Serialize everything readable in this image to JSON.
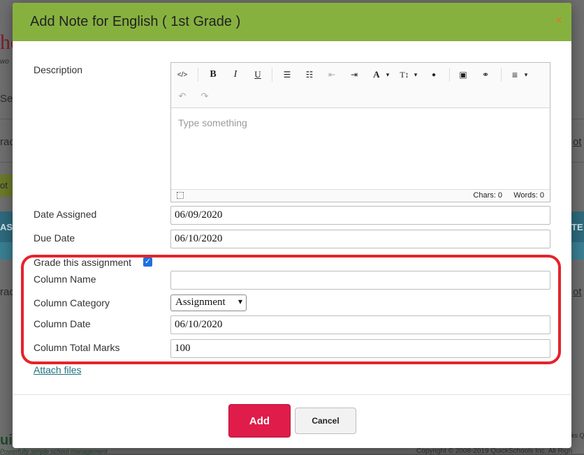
{
  "background": {
    "logo_fragment": "he",
    "fragment_tagline": "wo",
    "fragment_1": "Ser",
    "fragment_2": "rac",
    "fragment_3": "ot",
    "fragment_4": "ot",
    "fragment_5": "ASS",
    "fragment_6": "TE",
    "fragment_7": "rac",
    "fragment_8": "ot",
    "fragment_9": "ui",
    "footer_tagline": "Powerfully simple school management",
    "footer_right": "ks Q",
    "copyright": "Copyright © 2008-2019 QuickSchools Inc. All Righ"
  },
  "modal": {
    "title": "Add Note for English ( 1st Grade )",
    "close_symbol": "×"
  },
  "form": {
    "description_label": "Description",
    "editor": {
      "toolbar": {
        "code": "</>",
        "bold": "B",
        "italic": "I",
        "underline": "U",
        "bullet_list": "☰",
        "numbered_list": "☷",
        "outdent": "⇤",
        "indent": "⇥",
        "font_color": "A",
        "font_size": "T↕",
        "ink": "●",
        "image": "▣",
        "link": "⚭",
        "align": "≡",
        "dropdown": "▾",
        "undo": "↶",
        "redo": "↷"
      },
      "placeholder": "Type something",
      "chars_label": "Chars: 0",
      "words_label": "Words: 0"
    },
    "date_assigned_label": "Date Assigned",
    "date_assigned_value": "06/09/2020",
    "due_date_label": "Due Date",
    "due_date_value": "06/10/2020",
    "grade_label": "Grade this assignment",
    "grade_checked": true,
    "checkmark": "✓",
    "column_name_label": "Column Name",
    "column_name_value": "",
    "column_category_label": "Column Category",
    "column_category_value": "Assignment",
    "column_date_label": "Column Date",
    "column_date_value": "06/10/2020",
    "column_total_label": "Column Total Marks",
    "column_total_value": "100",
    "attach_label": "Attach files"
  },
  "buttons": {
    "add": "Add",
    "cancel": "Cancel"
  },
  "colors": {
    "header": "#87b13f",
    "add_button": "#e01c4b",
    "highlight": "#e5232b",
    "link": "#1e6f7d"
  }
}
